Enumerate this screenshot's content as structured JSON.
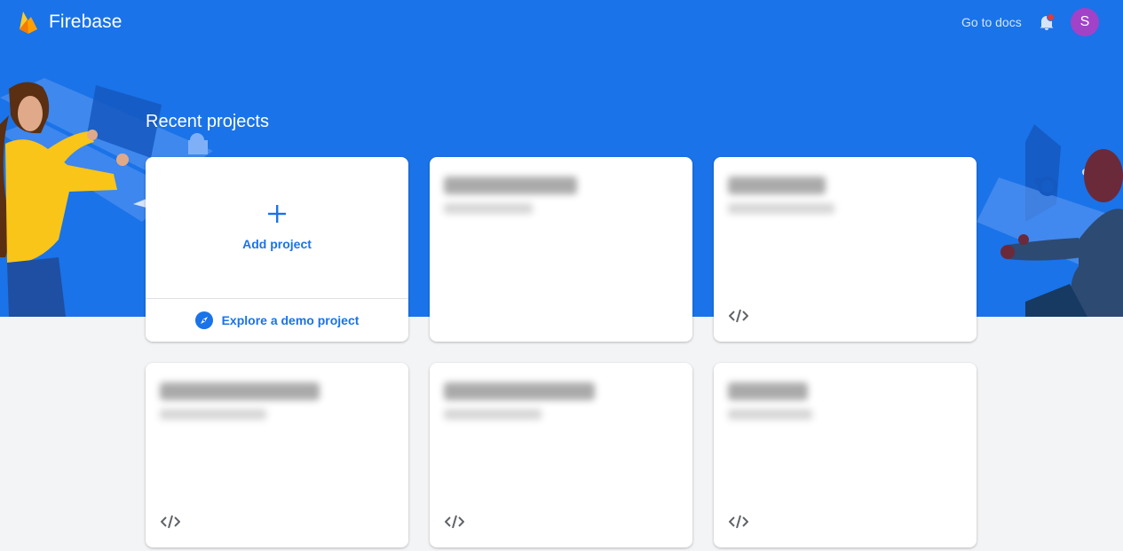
{
  "header": {
    "brand": "Firebase",
    "docs_link": "Go to docs",
    "avatar_initial": "S",
    "icons": [
      "firebase-flame-icon",
      "bell-icon"
    ]
  },
  "main": {
    "title": "Recent projects",
    "add_card": {
      "label": "Add project",
      "demo_label": "Explore a demo project",
      "icons": [
        "plus-icon",
        "compass-icon"
      ]
    },
    "project_cards": [
      {
        "title": "",
        "subtitle": "",
        "platform_icon": "code-icon",
        "redacted": true
      },
      {
        "title": "",
        "subtitle": "",
        "platform_icon": "code-icon",
        "redacted": true
      },
      {
        "title": "",
        "subtitle": "",
        "platform_icon": "code-icon",
        "redacted": true
      },
      {
        "title": "",
        "subtitle": "",
        "platform_icon": "code-icon",
        "redacted": true
      },
      {
        "title": "",
        "subtitle": "",
        "platform_icon": "code-icon",
        "redacted": true
      }
    ]
  },
  "colors": {
    "hero_blue": "#1a73e8",
    "page_background": "#f3f4f6",
    "avatar": "#a142c9",
    "notification_dot": "#e53935"
  }
}
